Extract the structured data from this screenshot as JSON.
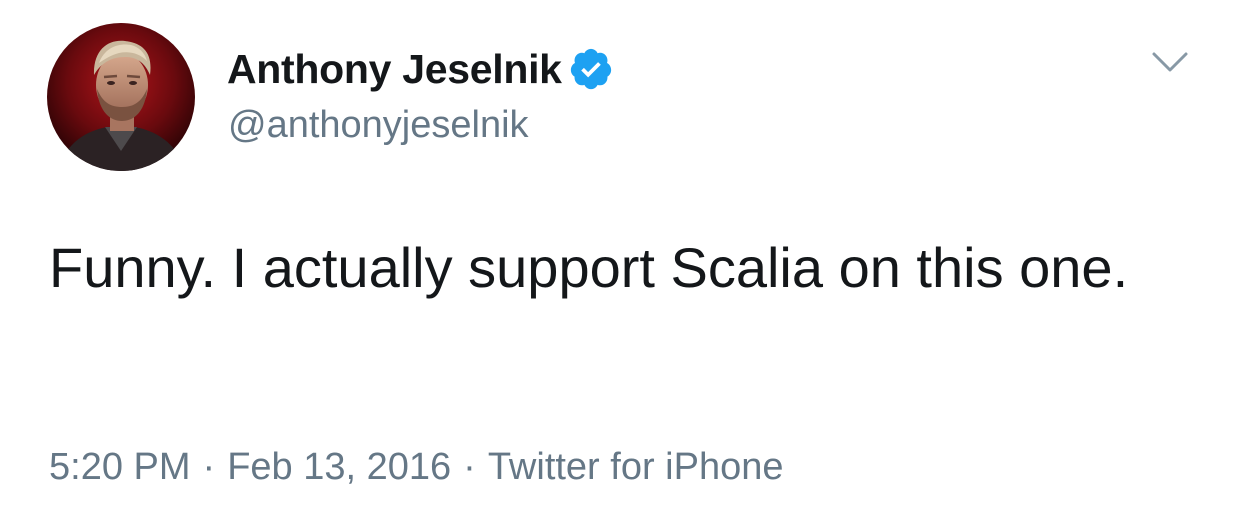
{
  "author": {
    "display_name": "Anthony Jeselnik",
    "handle": "@anthonyjeselnik",
    "verified": true,
    "verified_icon": "verified-badge-icon",
    "verified_color": "#1da1f2"
  },
  "tweet": {
    "text": "Funny. I actually support Scalia on this one."
  },
  "meta": {
    "time": "5:20 PM",
    "date": "Feb 13, 2016",
    "source": "Twitter for iPhone",
    "separator": "·"
  },
  "menu": {
    "icon": "chevron-down-icon"
  },
  "colors": {
    "primary_text": "#14171a",
    "secondary_text": "#657786",
    "chevron": "#8899a6"
  }
}
